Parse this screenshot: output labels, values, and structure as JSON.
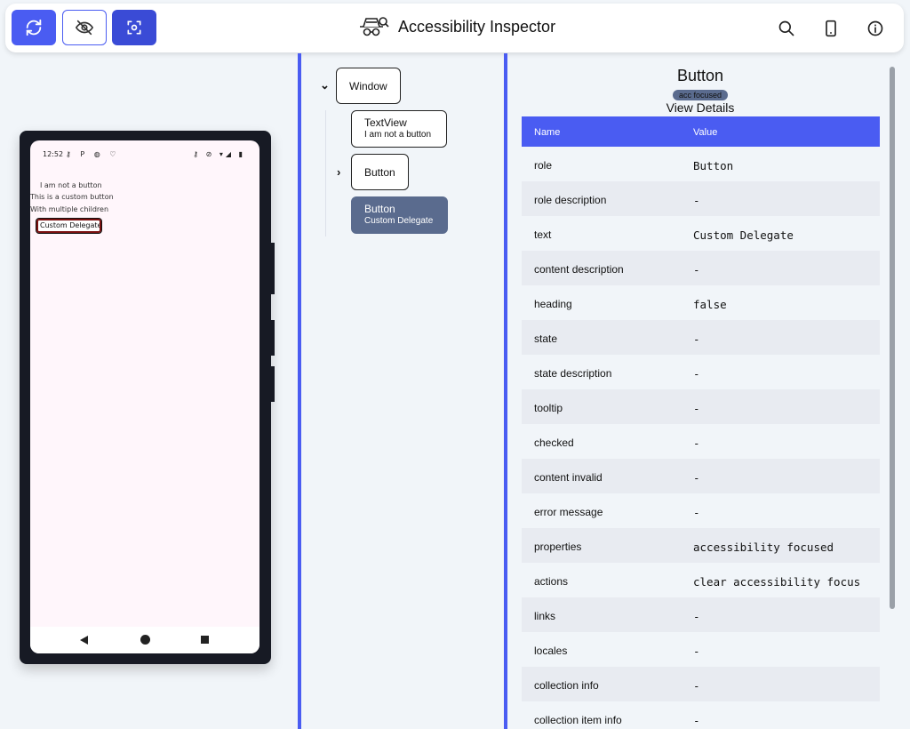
{
  "app": {
    "title": "Accessibility Inspector"
  },
  "toolbar": {
    "refresh_icon": "refresh-icon",
    "visibility_icon": "eye-off-icon",
    "focus_icon": "focus-scan-icon",
    "logo_icon": "incognito-inspector-icon",
    "search_icon": "search-icon",
    "device_icon": "phone-icon",
    "info_icon": "info-icon"
  },
  "device": {
    "status_time": "12:52",
    "status_left_icons": "⚷ P ◍ ♡",
    "status_right_icons": "⚷ ⊘ ▾◢ ▮",
    "texts": [
      "I am not a button",
      "This is a custom button",
      "With multiple children"
    ],
    "custom_button": "Custom Delegate"
  },
  "tree": {
    "root": "Window",
    "children": [
      {
        "label": "TextView",
        "sub": "I am not a button"
      },
      {
        "label": "Button",
        "sub": ""
      },
      {
        "label": "Button",
        "sub": "Custom Delegate"
      }
    ]
  },
  "details": {
    "title": "Button",
    "badge": "acc focused",
    "view_details": "View Details",
    "header": {
      "name": "Name",
      "value": "Value"
    },
    "rows": [
      {
        "name": "role",
        "value": "Button"
      },
      {
        "name": "role description",
        "value": "-"
      },
      {
        "name": "text",
        "value": "Custom Delegate"
      },
      {
        "name": "content description",
        "value": "-"
      },
      {
        "name": "heading",
        "value": "false"
      },
      {
        "name": "state",
        "value": "-"
      },
      {
        "name": "state description",
        "value": "-"
      },
      {
        "name": "tooltip",
        "value": "-"
      },
      {
        "name": "checked",
        "value": "-"
      },
      {
        "name": "content invalid",
        "value": "-"
      },
      {
        "name": "error message",
        "value": "-"
      },
      {
        "name": "properties",
        "value": "accessibility focused"
      },
      {
        "name": "actions",
        "value": "clear accessibility focus"
      },
      {
        "name": "links",
        "value": "-"
      },
      {
        "name": "locales",
        "value": "-"
      },
      {
        "name": "collection info",
        "value": "-"
      },
      {
        "name": "collection item info",
        "value": "-"
      }
    ]
  },
  "colors": {
    "accent": "#4a5cf2",
    "selected_node": "#5a6b8e",
    "row_alt": "#e8ebf1"
  }
}
